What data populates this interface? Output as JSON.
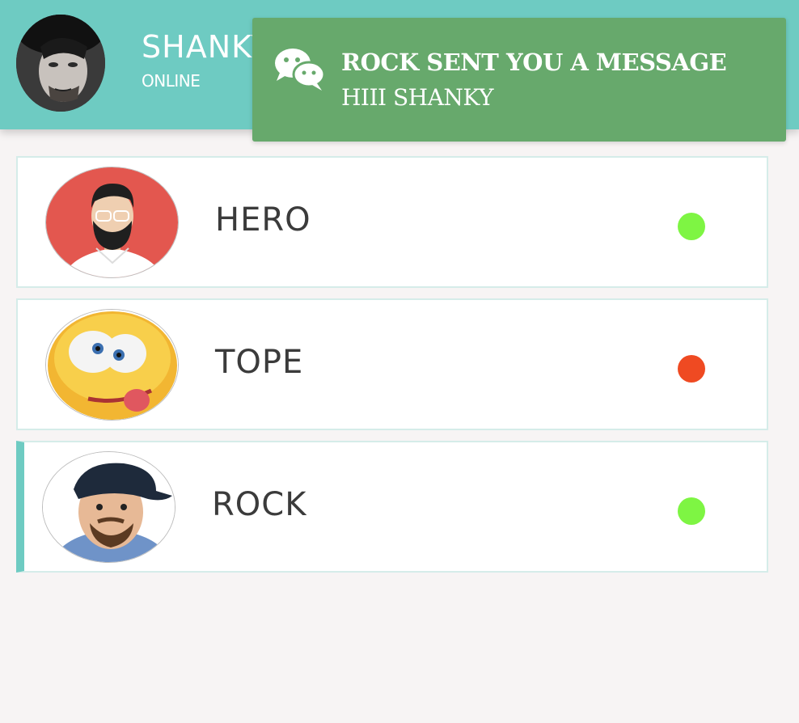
{
  "header": {
    "user_name": "SHANKY",
    "status": "ONLINE",
    "avatar_icon": "user-avatar",
    "profile_icon": "user-icon",
    "power_icon": "power-icon"
  },
  "notification": {
    "icon": "wechat-icon",
    "title": "ROCK SENT YOU A MESSAGE",
    "message": "HIII SHANKY",
    "color": "#67a96c"
  },
  "contacts": [
    {
      "name": "HERO",
      "status_color": "#7ef543",
      "status": "online"
    },
    {
      "name": "TOPE",
      "status_color": "#ef4a22",
      "status": "offline"
    },
    {
      "name": "ROCK",
      "status_color": "#7ef543",
      "status": "online"
    }
  ],
  "colors": {
    "accent": "#6ecbc2",
    "online": "#7ef543",
    "offline": "#ef4a22"
  }
}
